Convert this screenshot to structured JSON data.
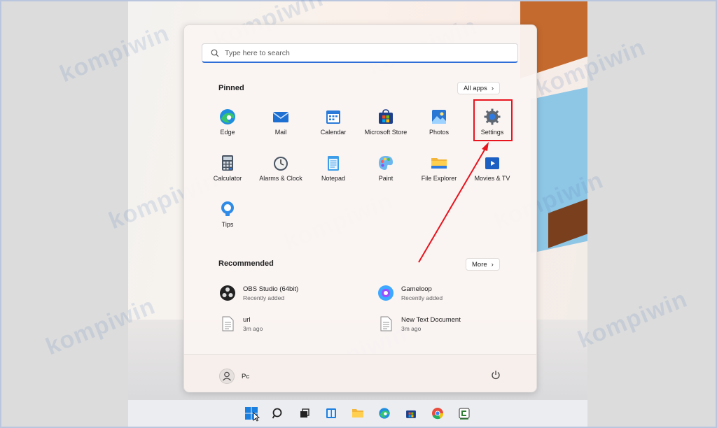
{
  "search": {
    "placeholder": "Type here to search"
  },
  "pinned": {
    "title": "Pinned",
    "all_apps_label": "All apps",
    "apps": [
      {
        "label": "Edge",
        "icon": "edge-icon"
      },
      {
        "label": "Mail",
        "icon": "mail-icon"
      },
      {
        "label": "Calendar",
        "icon": "calendar-icon"
      },
      {
        "label": "Microsoft Store",
        "icon": "store-icon"
      },
      {
        "label": "Photos",
        "icon": "photos-icon"
      },
      {
        "label": "Settings",
        "icon": "gear-icon"
      },
      {
        "label": "Calculator",
        "icon": "calculator-icon"
      },
      {
        "label": "Alarms & Clock",
        "icon": "clock-icon"
      },
      {
        "label": "Notepad",
        "icon": "notepad-icon"
      },
      {
        "label": "Paint",
        "icon": "paint-icon"
      },
      {
        "label": "File Explorer",
        "icon": "folder-icon"
      },
      {
        "label": "Movies & TV",
        "icon": "movies-icon"
      },
      {
        "label": "Tips",
        "icon": "tips-icon"
      }
    ]
  },
  "recommended": {
    "title": "Recommended",
    "more_label": "More",
    "items": [
      {
        "name": "OBS Studio (64bit)",
        "sub": "Recently added",
        "icon": "obs-icon"
      },
      {
        "name": "Gameloop",
        "sub": "Recently added",
        "icon": "gameloop-icon"
      },
      {
        "name": "url",
        "sub": "3m ago",
        "icon": "document-icon"
      },
      {
        "name": "New Text Document",
        "sub": "3m ago",
        "icon": "document-icon"
      }
    ]
  },
  "footer": {
    "user_name": "Pc"
  },
  "watermark": "kompiwin",
  "colors": {
    "accent": "#2f6ed6",
    "highlight": "#e8141e",
    "arrow": "#e8141e"
  }
}
